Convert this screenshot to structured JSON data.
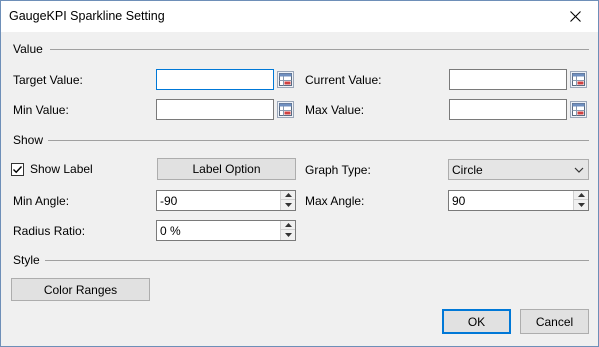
{
  "window": {
    "title": "GaugeKPI Sparkline Setting"
  },
  "sections": {
    "value": "Value",
    "show": "Show",
    "style": "Style"
  },
  "value": {
    "target_label": "Target Value:",
    "target_value": "",
    "current_label": "Current Value:",
    "current_value": "",
    "min_label": "Min Value:",
    "min_value": "",
    "max_label": "Max Value:",
    "max_value": ""
  },
  "show": {
    "show_label_text": "Show Label",
    "show_label_checked": true,
    "label_option_button": "Label Option",
    "graph_type_label": "Graph Type:",
    "graph_type_value": "Circle",
    "min_angle_label": "Min Angle:",
    "min_angle_value": "-90",
    "max_angle_label": "Max Angle:",
    "max_angle_value": "90",
    "radius_ratio_label": "Radius Ratio:",
    "radius_ratio_value": "0 %"
  },
  "style": {
    "color_ranges_button": "Color Ranges"
  },
  "footer": {
    "ok_button": "OK",
    "cancel_button": "Cancel"
  },
  "icons": {
    "close": "close-icon",
    "cell_picker": "cell-range-picker-icon",
    "checkmark": "checkmark-icon",
    "dropdown": "chevron-down-icon",
    "spin_up": "spin-up-arrow-icon",
    "spin_down": "spin-down-arrow-icon"
  },
  "colors": {
    "accent": "#0078d7",
    "dialog_bg": "#f0f0f0",
    "button_bg": "#e1e1e1"
  }
}
